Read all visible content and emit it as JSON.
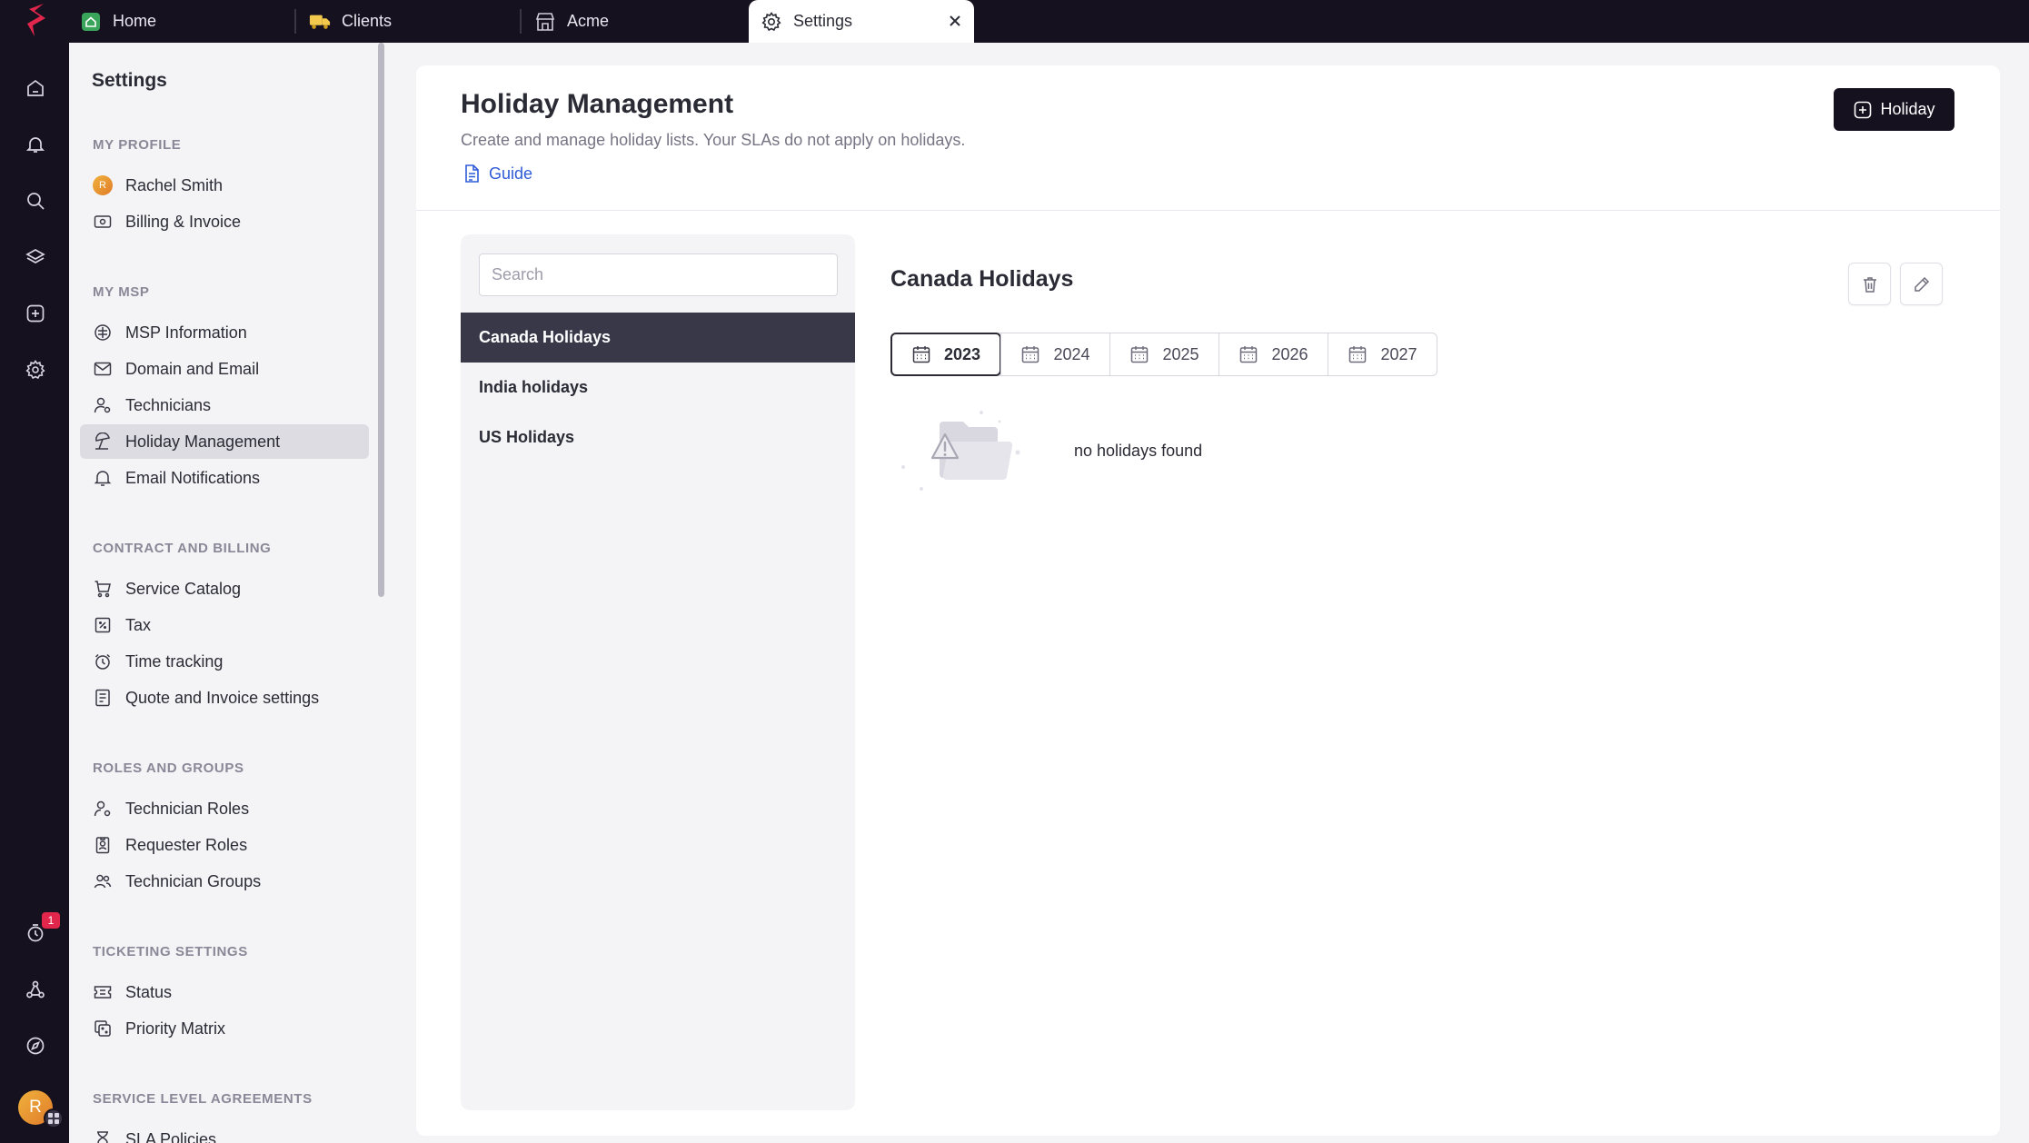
{
  "tabs": [
    {
      "label": "Home",
      "icon": "home-app-icon"
    },
    {
      "label": "Clients",
      "icon": "truck-icon"
    },
    {
      "label": "Acme",
      "icon": "store-icon"
    },
    {
      "label": "Settings",
      "icon": "gear-icon",
      "active": true
    }
  ],
  "rail": {
    "icons": [
      "home-icon",
      "bell-icon",
      "search-icon",
      "layers-icon",
      "plus-square-icon",
      "settings-icon",
      "timer-icon",
      "workflow-icon",
      "compass-icon"
    ],
    "timer_badge": "1",
    "avatar_initial": "R"
  },
  "sidebar": {
    "title": "Settings",
    "sections": [
      {
        "heading": "MY PROFILE",
        "items": [
          {
            "label": "Rachel Smith",
            "avatar_initial": "R"
          },
          {
            "label": "Billing & Invoice"
          }
        ]
      },
      {
        "heading": "MY MSP",
        "items": [
          {
            "label": "MSP Information"
          },
          {
            "label": "Domain and Email"
          },
          {
            "label": "Technicians"
          },
          {
            "label": "Holiday Management",
            "active": true
          },
          {
            "label": "Email Notifications"
          }
        ]
      },
      {
        "heading": "CONTRACT AND BILLING",
        "items": [
          {
            "label": "Service Catalog"
          },
          {
            "label": "Tax"
          },
          {
            "label": "Time tracking"
          },
          {
            "label": "Quote and Invoice settings"
          }
        ]
      },
      {
        "heading": "ROLES AND GROUPS",
        "items": [
          {
            "label": "Technician Roles"
          },
          {
            "label": "Requester Roles"
          },
          {
            "label": "Technician Groups"
          }
        ]
      },
      {
        "heading": "TICKETING SETTINGS",
        "items": [
          {
            "label": "Status"
          },
          {
            "label": "Priority Matrix"
          }
        ]
      },
      {
        "heading": "SERVICE LEVEL AGREEMENTS",
        "items": [
          {
            "label": "SLA Policies"
          }
        ]
      }
    ]
  },
  "header": {
    "title": "Holiday Management",
    "subtitle": "Create and manage holiday lists. Your SLAs do not apply on holidays.",
    "guide_label": "Guide",
    "add_button_label": "Holiday"
  },
  "holiday_lists": {
    "search_placeholder": "Search",
    "items": [
      {
        "label": "Canada Holidays",
        "active": true
      },
      {
        "label": "India holidays"
      },
      {
        "label": "US Holidays"
      }
    ]
  },
  "detail": {
    "title": "Canada Holidays",
    "years": [
      "2023",
      "2024",
      "2025",
      "2026",
      "2027"
    ],
    "selected_year": "2023",
    "empty_message": "no holidays found"
  },
  "colors": {
    "brand": "#e0264b",
    "dark": "#15111f",
    "active_list": "#393848",
    "link": "#2f5bd8"
  }
}
